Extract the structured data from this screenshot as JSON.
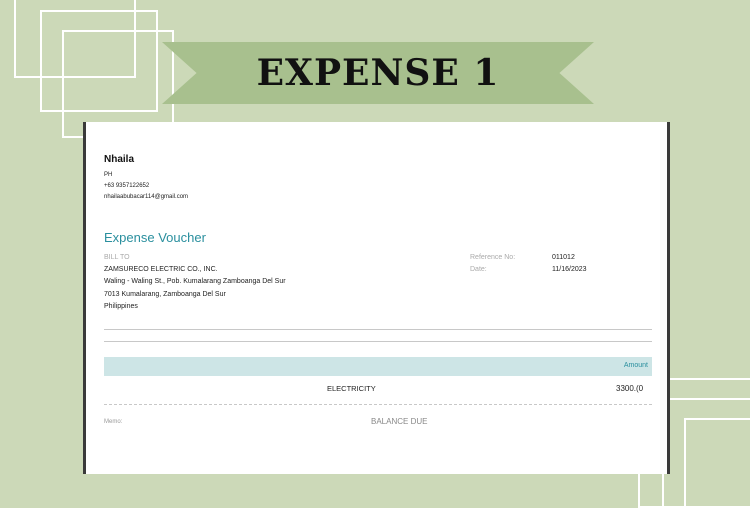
{
  "banner": {
    "title": "EXPENSE 1"
  },
  "company": {
    "name": "Nhaila",
    "country": "PH",
    "phone": "+63 9357122652",
    "email": "nhailaabubacar114@gmail.com"
  },
  "voucher": {
    "title": "Expense Voucher",
    "bill_to_label": "BILL TO",
    "bill_to_lines": [
      "ZAMSURECO ELECTRIC CO., INC.",
      "Waling - Waling St., Pob. Kumalarang Zamboanga Del Sur",
      "7013 Kumalarang, Zamboanga Del Sur",
      "Philippines"
    ],
    "reference_label": "Reference No:",
    "reference_value": "011012",
    "date_label": "Date:",
    "date_value": "11/16/2023"
  },
  "table": {
    "amount_header": "Amount",
    "rows": [
      {
        "description": "ELECTRICITY",
        "amount": "3300.(0"
      }
    ]
  },
  "footer": {
    "memo_label": "Memo:",
    "balance_label": "BALANCE DUE"
  }
}
